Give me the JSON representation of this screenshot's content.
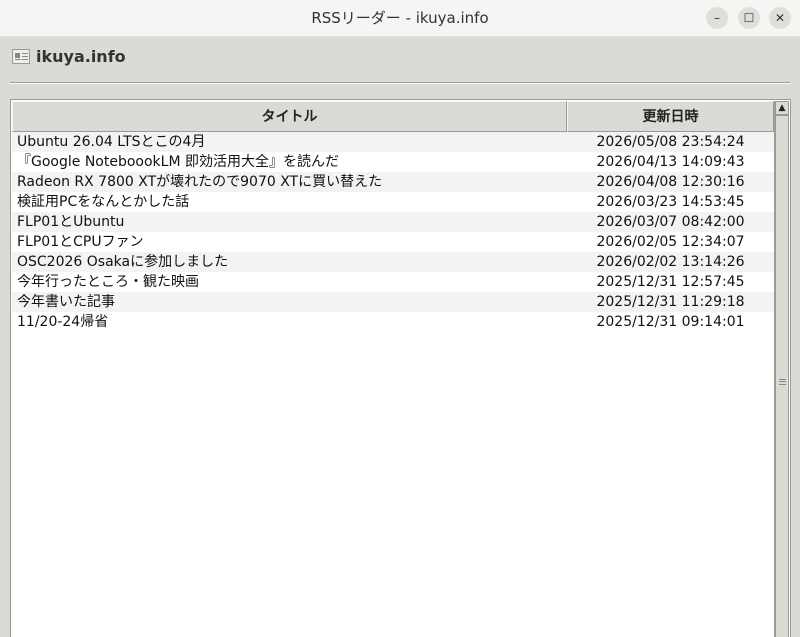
{
  "window": {
    "title": "RSSリーダー - ikuya.info",
    "buttons": {
      "minimize": "–",
      "maximize": "☐",
      "close": "✕"
    }
  },
  "feed": {
    "title": "ikuya.info"
  },
  "table": {
    "columns": {
      "title": "タイトル",
      "date": "更新日時"
    },
    "rows": [
      {
        "title": "Ubuntu 26.04 LTSとこの4月",
        "date": "2026/05/08 23:54:24"
      },
      {
        "title": "『Google NoteboookLM 即効活用大全』を読んだ",
        "date": "2026/04/13 14:09:43"
      },
      {
        "title": "Radeon RX 7800 XTが壊れたので9070 XTに買い替えた",
        "date": "2026/04/08 12:30:16"
      },
      {
        "title": "検証用PCをなんとかした話",
        "date": "2026/03/23 14:53:45"
      },
      {
        "title": "FLP01とUbuntu",
        "date": "2026/03/07 08:42:00"
      },
      {
        "title": "FLP01とCPUファン",
        "date": "2026/02/05 12:34:07"
      },
      {
        "title": "OSC2026 Osakaに参加しました",
        "date": "2026/02/02 13:14:26"
      },
      {
        "title": "今年行ったところ・観た映画",
        "date": "2025/12/31 12:57:45"
      },
      {
        "title": "今年書いた記事",
        "date": "2025/12/31 11:29:18"
      },
      {
        "title": "11/20-24帰省",
        "date": "2025/12/31 09:14:01"
      }
    ]
  },
  "scrollbar": {
    "up": "▲",
    "down": "▼"
  }
}
